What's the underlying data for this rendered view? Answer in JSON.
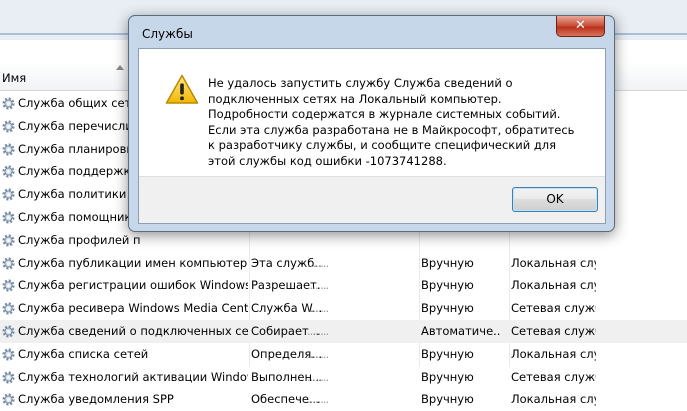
{
  "list": {
    "column_name": "Имя",
    "rows": [
      {
        "name": "Служба общих сетев",
        "desc": "",
        "start": "",
        "logon": ""
      },
      {
        "name": "Служба перечислите",
        "desc": "",
        "start": "",
        "logon": ""
      },
      {
        "name": "Служба планировщи",
        "desc": "",
        "start": "",
        "logon": ""
      },
      {
        "name": "Служба поддержки В",
        "desc": "",
        "start": "",
        "logon": ""
      },
      {
        "name": "Служба политики ди",
        "desc": "",
        "start": "",
        "logon": ""
      },
      {
        "name": "Служба помощника",
        "desc": "",
        "start": "",
        "logon": ""
      },
      {
        "name": "Служба профилей п",
        "desc": "",
        "start": "",
        "logon": ""
      },
      {
        "name": "Служба публикации имен компьютер...",
        "desc": "Эта служб...",
        "start": "Вручную",
        "logon": "Локальная слу..."
      },
      {
        "name": "Служба регистрации ошибок Windows",
        "desc": "Разрешает...",
        "start": "Вручную",
        "logon": "Локальная слу..."
      },
      {
        "name": "Служба ресивера Windows Media Center",
        "desc": "Служба W...",
        "start": "Вручную",
        "logon": "Сетевая служба"
      },
      {
        "name": "Служба сведений о подключенных сетях",
        "desc": "Собирает ...",
        "start": "Автоматиче...",
        "logon": "Сетевая служба"
      },
      {
        "name": "Служба списка сетей",
        "desc": "Определя...",
        "start": "Вручную",
        "logon": "Локальная слу..."
      },
      {
        "name": "Служба технологий активации Windows",
        "desc": "Выполнен...",
        "start": "Вручную",
        "logon": "Сетевая служба"
      },
      {
        "name": "Служба уведомления SPP",
        "desc": "Обеспече...",
        "start": "Вручную",
        "logon": "Локальная слу..."
      }
    ]
  },
  "dialog": {
    "title": "Службы",
    "close_label": "✕",
    "message": "Не удалось запустить службу Служба сведений о подключенных сетях на Локальный компьютер. Подробности содержатся в журнале системных событий. Если эта служба разработана не в Майкрософт, обратитесь к разработчику службы, и сообщите специфический для этой службы код ошибки -1073741288.",
    "ok_label": "OK",
    "icon": "warning-icon"
  }
}
